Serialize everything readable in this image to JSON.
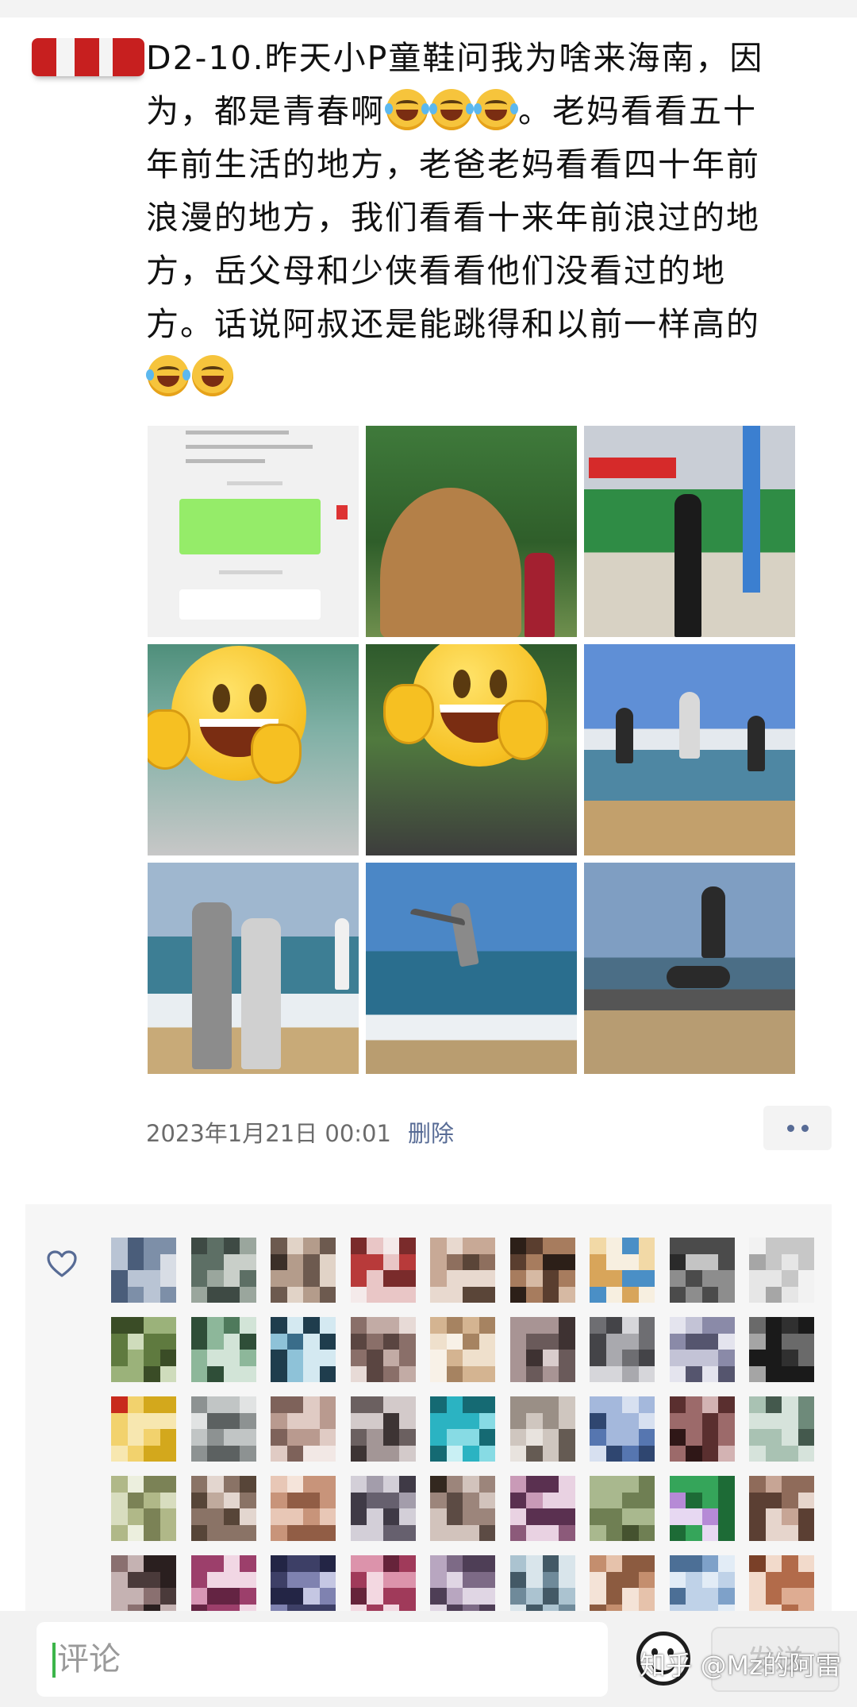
{
  "post": {
    "text_line1": "D2-10.昨天小P童鞋问我为啥来海南，因",
    "text_line2a": "为，都是青春啊",
    "text_line2b": "。老妈看看五十",
    "text_line3": "年前生活的地方，老爸老妈看看四十年前",
    "text_line4": "浪漫的地方，我们看看十来年前浪过的地",
    "text_line5": "方，岳父母和少侠看看他们没看过的地",
    "text_line6": "方。话说阿叔还是能跳得和以前一样高的",
    "emoji_icons": [
      "laugh-cry-emoji",
      "laugh-cry-emoji",
      "laugh-cry-emoji",
      "laugh-cry-emoji",
      "facepalm-emoji"
    ]
  },
  "photos": [
    {
      "name": "photo-chat-screenshot"
    },
    {
      "name": "photo-rock-inscription"
    },
    {
      "name": "photo-street-person"
    },
    {
      "name": "photo-covered-face-1"
    },
    {
      "name": "photo-covered-face-2"
    },
    {
      "name": "photo-beach-jump-trio"
    },
    {
      "name": "photo-beach-couple"
    },
    {
      "name": "photo-beach-jump"
    },
    {
      "name": "photo-rocks-jump"
    }
  ],
  "meta": {
    "timestamp": "2023年1月21日 00:01",
    "delete_label": "删除",
    "more_icon": "more-dots-icon"
  },
  "likes": {
    "icon": "heart-icon",
    "avatar_count": 45
  },
  "comment_bar": {
    "placeholder": "评论",
    "emoji_icon": "smiley-icon",
    "send_label": "发送",
    "watermark": "知乎 @Mz的阿雷"
  },
  "colors": {
    "link": "#576b95",
    "timestamp": "#6b6b6b",
    "panel_bg": "#f6f6f6",
    "caret": "#3cb54a"
  }
}
